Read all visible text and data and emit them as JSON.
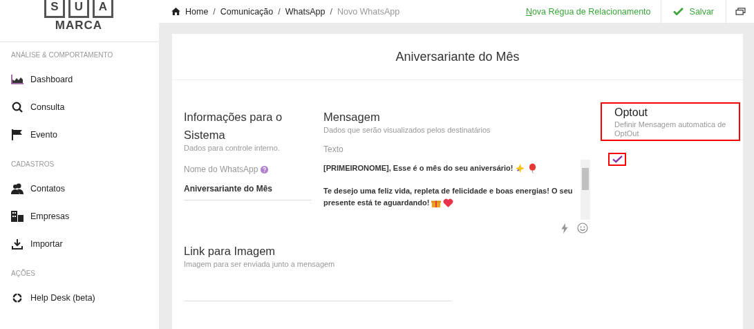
{
  "logo": {
    "letters": [
      "S",
      "U",
      "A"
    ],
    "word": "MARCA"
  },
  "sidebar": {
    "sections": [
      {
        "title": "ANÁLISE & COMPORTAMENTO",
        "items": [
          {
            "label": "Dashboard"
          },
          {
            "label": "Consulta"
          },
          {
            "label": "Evento"
          }
        ]
      },
      {
        "title": "CADASTROS",
        "items": [
          {
            "label": "Contatos"
          },
          {
            "label": "Empresas"
          },
          {
            "label": "Importar"
          }
        ]
      },
      {
        "title": "AÇÕES",
        "items": [
          {
            "label": "Help Desk (beta)"
          }
        ]
      }
    ]
  },
  "breadcrumb": {
    "separator": "/",
    "items": [
      "Home",
      "Comunicação",
      "WhatsApp",
      "Novo WhatsApp"
    ]
  },
  "topbar": {
    "link": "Nova Régua de Relacionamento",
    "save": "Salvar"
  },
  "card": {
    "title": "Aniversariante do Mês",
    "info": {
      "title": "Informações para o Sistema",
      "subtitle": "Dados para controle interno.",
      "field_label": "Nome do WhatsApp",
      "field_value": "Aniversariante do Mês"
    },
    "message": {
      "title": "Mensagem",
      "subtitle": "Dados que serão visualizados pelos destinatários",
      "field_label": "Texto",
      "paragraphs": [
        {
          "lines": [
            "[PRIMEIRONOME], Esse é o mês do seu aniversário!"
          ]
        },
        {
          "lines": [
            "Te desejo uma feliz vida, repleta de felicidade e boas energias! O seu",
            "presente está te aguardando!"
          ]
        }
      ]
    },
    "optout": {
      "title": "Optout",
      "subtitle": "Definir Mensagem automatica de OptOut",
      "checked": true
    },
    "image_link": {
      "title": "Link para Imagem",
      "subtitle": "Imagem para ser enviada junto a mensagem"
    }
  }
}
